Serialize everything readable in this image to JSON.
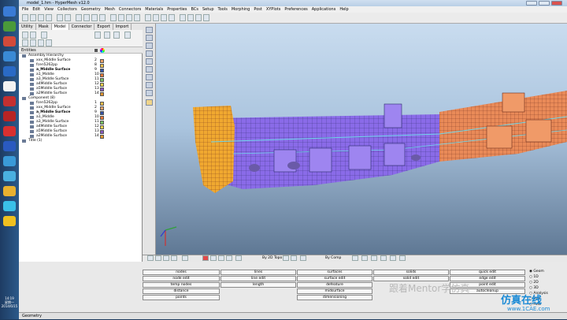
{
  "window": {
    "title": "model_1.hm - HyperMesh v12.0"
  },
  "menu": [
    "File",
    "Edit",
    "View",
    "Collectors",
    "Geometry",
    "Mesh",
    "Connectors",
    "Materials",
    "Properties",
    "BCs",
    "Setup",
    "Tools",
    "Morphing",
    "Post",
    "XYPlots",
    "Preferences",
    "Applications",
    "Help"
  ],
  "tabs": [
    "Utility",
    "Mask",
    "Model",
    "Connector",
    "Export",
    "Import"
  ],
  "entities_header": "Entities",
  "tree": [
    {
      "label": "Assembly Hierarchy",
      "level": 0,
      "num": "",
      "color": null,
      "bold": false
    },
    {
      "label": "xxx_Middle Surface",
      "level": 1,
      "num": "2",
      "color": "#e8a36a",
      "bold": false
    },
    {
      "label": "fcen5262pp",
      "level": 1,
      "num": "8",
      "color": "#f4c04a",
      "bold": false
    },
    {
      "label": "a_Middle Surface",
      "level": 1,
      "num": "9",
      "color": "#3454a8",
      "bold": true
    },
    {
      "label": "a1_Middle",
      "level": 1,
      "num": "10",
      "color": "#e87a3a",
      "bold": false
    },
    {
      "label": "a3_Middle Surface",
      "level": 1,
      "num": "11",
      "color": "#79c265",
      "bold": false
    },
    {
      "label": "a4Middle Surface",
      "level": 1,
      "num": "12",
      "color": "#f2d04a",
      "bold": false
    },
    {
      "label": "a5Middle Surface",
      "level": 1,
      "num": "13",
      "color": "#8a5ac2",
      "bold": false
    },
    {
      "label": "a2Middle Surface",
      "level": 1,
      "num": "14",
      "color": "#e2962f",
      "bold": false
    },
    {
      "label": "Component (8)",
      "level": 0,
      "num": "",
      "color": null,
      "bold": false
    },
    {
      "label": "fcen5262pp",
      "level": 1,
      "num": "1",
      "color": "#f4c04a",
      "bold": false
    },
    {
      "label": "xxx_Middle Surface",
      "level": 1,
      "num": "2",
      "color": "#e8a36a",
      "bold": false
    },
    {
      "label": "a_Middle Surface",
      "level": 1,
      "num": "9",
      "color": "#3454a8",
      "bold": true
    },
    {
      "label": "a1_Middle",
      "level": 1,
      "num": "10",
      "color": "#e87a3a",
      "bold": false
    },
    {
      "label": "a3_Middle Surface",
      "level": 1,
      "num": "11",
      "color": "#79c265",
      "bold": false
    },
    {
      "label": "a4Middle Surface",
      "level": 1,
      "num": "12",
      "color": "#f2d04a",
      "bold": false
    },
    {
      "label": "a5Middle Surface",
      "level": 1,
      "num": "13",
      "color": "#8a5ac2",
      "bold": false
    },
    {
      "label": "a2Middle Surface",
      "level": 1,
      "num": "14",
      "color": "#e2962f",
      "bold": false
    },
    {
      "label": "Title (1)",
      "level": 0,
      "num": "",
      "color": null,
      "bold": false
    }
  ],
  "viewbar": {
    "topo": "By 2D Topo",
    "comp": "By Comp"
  },
  "panels": {
    "col1": [
      "nodes",
      "node edit",
      "temp nodes",
      "distance",
      "points"
    ],
    "col2": [
      "lines",
      "line edit",
      "length"
    ],
    "col3": [
      "surfaces",
      "surface edit",
      "defeature",
      "midsurface",
      "dimensioning"
    ],
    "col4": [
      "solids",
      "solid edit"
    ],
    "col5": [
      "quick edit",
      "edge edit",
      "point edit",
      "autocleanup"
    ]
  },
  "page_radios": [
    "Geom",
    "1D",
    "2D",
    "3D",
    "Analysis",
    "Tool",
    "Post"
  ],
  "status": "Geometry",
  "clock": {
    "time": "14:19",
    "day": "星期一",
    "date": "2014/6/15"
  },
  "watermarks": {
    "wechat": "跟着Mentor学仿真",
    "brand": "仿真在线",
    "site": "www.1CAE.com"
  },
  "colors": {
    "orange": "#e98a58",
    "purple": "#8a6be8",
    "yellow": "#f0a830",
    "mesh": "#2a2a6a"
  }
}
